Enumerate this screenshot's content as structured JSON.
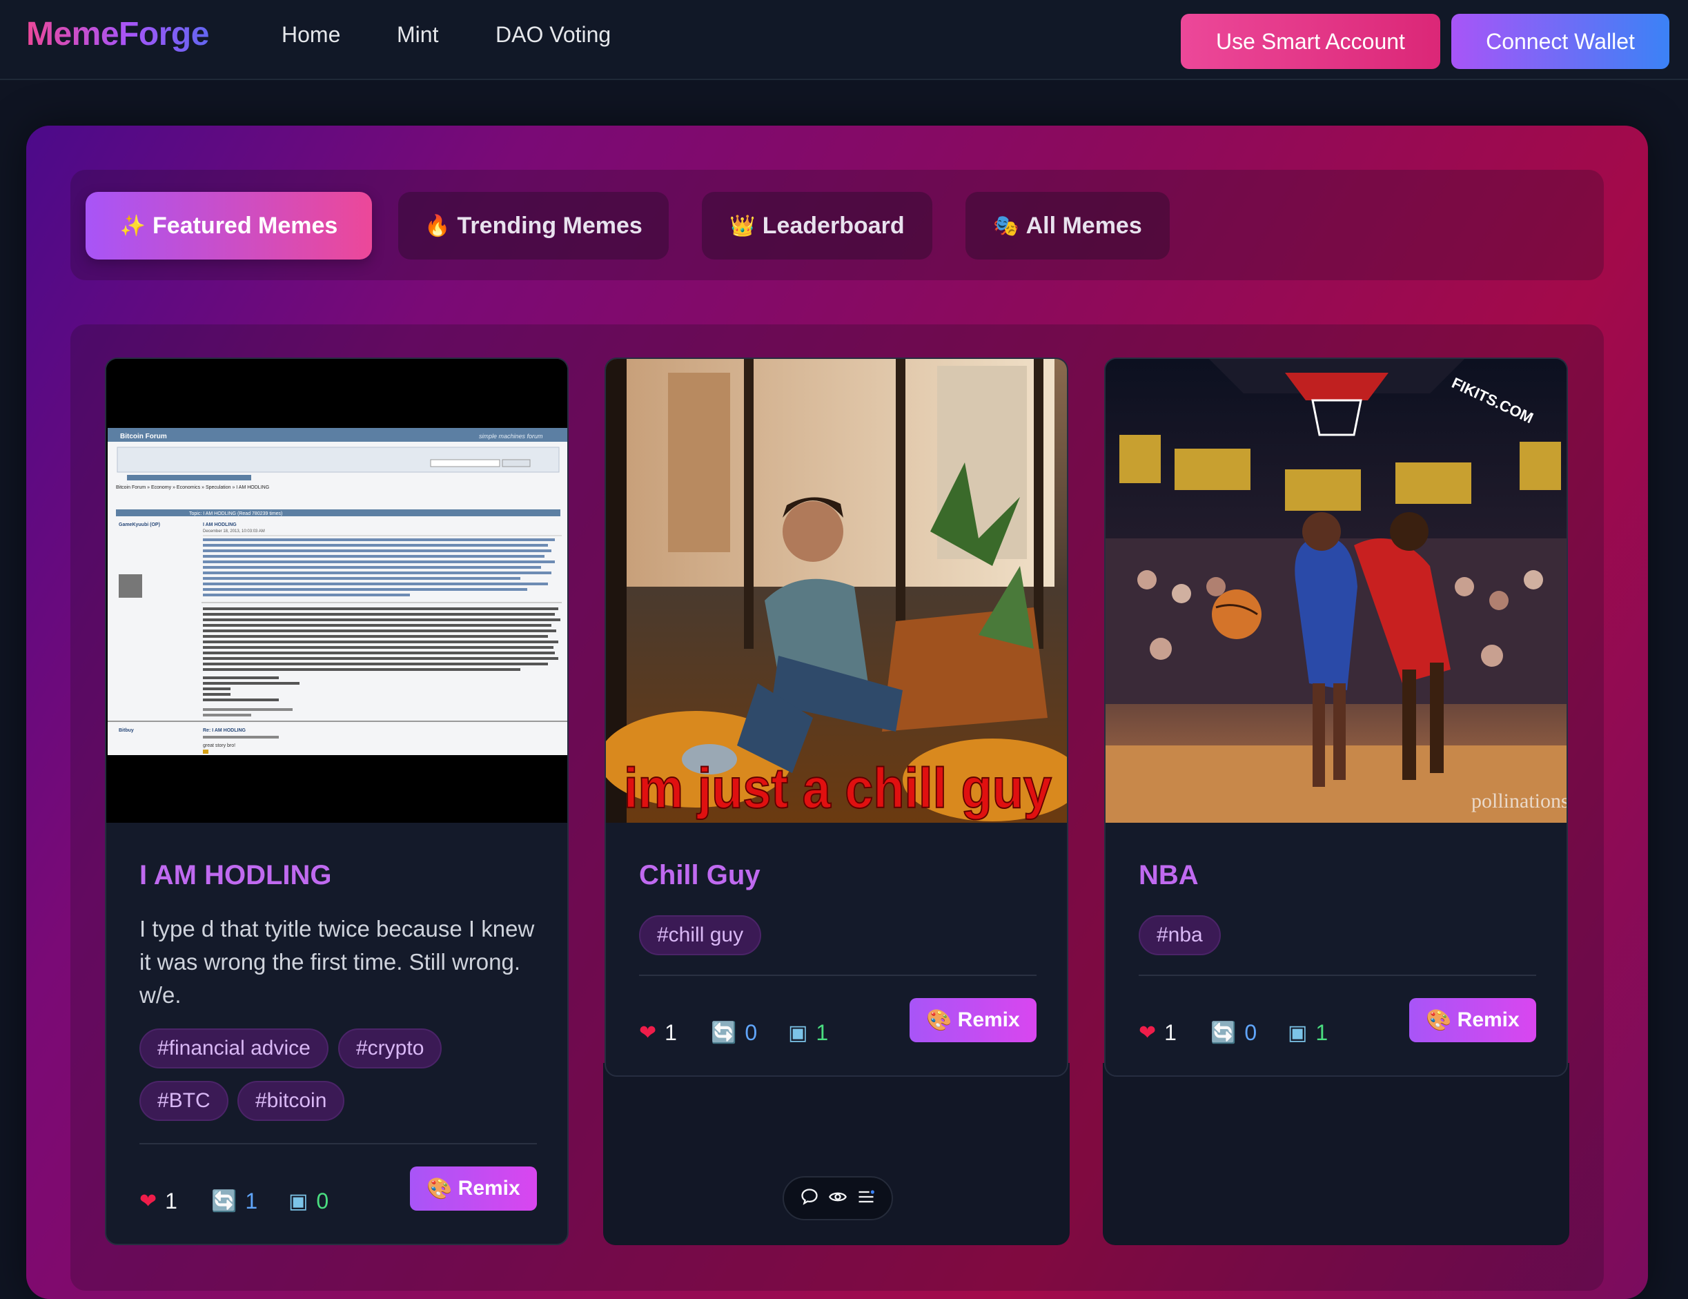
{
  "nav": {
    "logo": "MemeForge",
    "links": [
      "Home",
      "Mint",
      "DAO Voting"
    ],
    "smart_account_label": "Use Smart Account",
    "connect_wallet_label": "Connect Wallet"
  },
  "tabs": [
    {
      "icon": "✨",
      "label": "Featured Memes",
      "active": true
    },
    {
      "icon": "🔥",
      "label": "Trending Memes",
      "active": false
    },
    {
      "icon": "👑",
      "label": "Leaderboard",
      "active": false
    },
    {
      "icon": "🎭",
      "label": "All Memes",
      "active": false
    }
  ],
  "cards": [
    {
      "title": "I AM HODLING",
      "description": "I type d that tyitle twice because I knew it was wrong the first time. Still wrong. w/e.",
      "tags": [
        "#financial advice",
        "#crypto",
        "#BTC",
        "#bitcoin"
      ],
      "likes": "1",
      "remixes": "1",
      "mints": "0",
      "remix_label": "Remix",
      "image": {
        "forum_title": "Bitcoin Forum",
        "forum_brand": "simple machines forum",
        "breadcrumb": "Bitcoin Forum » Economy » Economics » Speculation » I AM HODLING",
        "topic": "Topic: I AM HODLING (Read 780239 times)",
        "author": "GameKyuubi (OP)",
        "post_title": "I AM HODLING",
        "post_date": "December 18, 2013, 10:03:03 AM",
        "reply_author": "Bitbuy",
        "reply_title": "Re: I AM HODLING",
        "reply_text": "great story bro!"
      }
    },
    {
      "title": "Chill Guy",
      "tags": [
        "#chill guy"
      ],
      "likes": "1",
      "remixes": "0",
      "mints": "1",
      "remix_label": "Remix",
      "image": {
        "caption": "im just a chill guy"
      }
    },
    {
      "title": "NBA",
      "tags": [
        "#nba"
      ],
      "likes": "1",
      "remixes": "0",
      "mints": "1",
      "remix_label": "Remix",
      "image": {
        "watermark": "pollinations.ai",
        "banner": "FIKITS.COM"
      }
    }
  ],
  "icons": {
    "like": "heart-icon",
    "remix": "repeat-icon",
    "mint": "cube-icon",
    "remix_button": "palette-icon"
  },
  "colors": {
    "accent_pink": "#ec4899",
    "accent_purple": "#a855f7",
    "accent_blue": "#3b82f6",
    "card_bg": "#141a2a",
    "title_purple": "#c06af0"
  }
}
